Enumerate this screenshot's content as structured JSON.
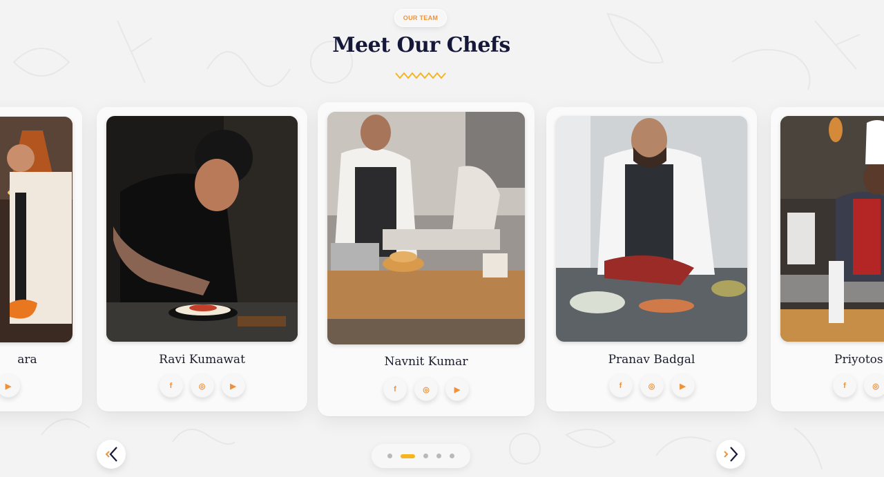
{
  "section": {
    "eyebrow": "OUR TEAM",
    "title": "Meet Our Chefs"
  },
  "colors": {
    "accent": "#f0913a",
    "title": "#151838",
    "zigzag": "#f5b520",
    "background": "#f3f3f4"
  },
  "chefs": [
    {
      "name": "ara",
      "socials": [
        "youtube-icon"
      ]
    },
    {
      "name": "Ravi Kumawat",
      "socials": [
        "facebook-icon",
        "instagram-icon",
        "youtube-icon"
      ]
    },
    {
      "name": "Navnit Kumar",
      "socials": [
        "facebook-icon",
        "instagram-icon",
        "youtube-icon"
      ]
    },
    {
      "name": "Pranav Badgal",
      "socials": [
        "facebook-icon",
        "instagram-icon",
        "youtube-icon"
      ]
    },
    {
      "name": "Priyotos",
      "socials": [
        "facebook-icon",
        "instagram-icon"
      ]
    }
  ],
  "social_glyphs": {
    "facebook": "f",
    "instagram": "◎",
    "youtube": "▶"
  },
  "nav": {
    "prev_icon": "chevron-left-icon",
    "next_icon": "chevron-right-icon"
  },
  "pagination": {
    "count": 5,
    "active": 2
  }
}
